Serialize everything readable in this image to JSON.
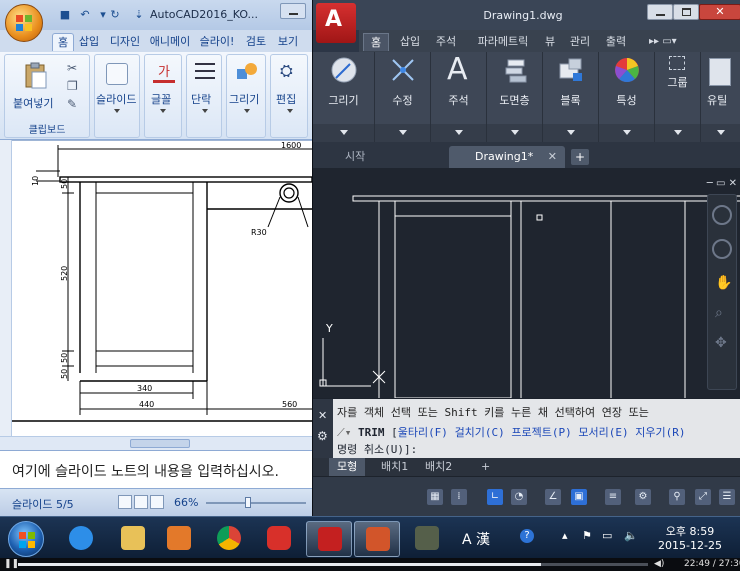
{
  "ppt": {
    "title": "AutoCAD2016_KO...",
    "tabs": [
      "홈",
      "삽입",
      "디자인",
      "애니메이",
      "슬라이!",
      "검토",
      "보기"
    ],
    "active_tab": "홈",
    "groups": {
      "clipboard": {
        "paste_label": "붙여넣기",
        "group_label": "클립보드"
      },
      "slides": {
        "label": "슬라이드"
      },
      "font": {
        "label": "글꼴"
      },
      "paragraph": {
        "label": "단락"
      },
      "drawing": {
        "label": "그리기"
      },
      "editing": {
        "label": "편집"
      }
    },
    "notes_text": "여기에 슬라이드 노트의 내용을 입력하십시오.",
    "status_slide": "슬라이드 5/5",
    "zoom": "66%",
    "drawing": {
      "dims": [
        "1600",
        "10",
        "50",
        "520",
        "50",
        "50",
        "340",
        "440",
        "560",
        "R30"
      ]
    }
  },
  "acad": {
    "logo_letter": "A",
    "title": "Drawing1.dwg",
    "tabs": [
      "홈",
      "삽입",
      "주석",
      "파라메트릭",
      "뷰",
      "관리",
      "출력"
    ],
    "active_tab": "홈",
    "panels": [
      "그리기",
      "수정",
      "주석",
      "도면층",
      "블록",
      "특성",
      "그룹",
      "유틸"
    ],
    "file_tabs": [
      "시작",
      "Drawing1*"
    ],
    "active_file_tab": "Drawing1*",
    "ucs_y_label": "Y",
    "command_history": "자를 객체 선택 또는 Shift 키를 누른 채 선택하여 연장 또는",
    "command_prompt": {
      "name": "TRIM",
      "options": [
        "울타리(F)",
        "걸치기(C)",
        "프로젝트(P)",
        "모서리(E)",
        "지우기(R)"
      ],
      "line2": "명령 취소(U)]:"
    },
    "layout_tabs": [
      "모형",
      "배치1",
      "배치2"
    ],
    "active_layout": "모형"
  },
  "taskbar": {
    "apps": [
      "ie",
      "explorer",
      "media-player",
      "chrome",
      "oneclick",
      "autocad",
      "powerpoint",
      "plugin"
    ],
    "active_apps": [
      "autocad",
      "powerpoint"
    ],
    "tray_lang": "A 漢",
    "time": "오후 8:59",
    "date": "2015-12-25"
  },
  "player": {
    "time": "22:49 / 27:30",
    "progress": 0.83
  },
  "colors": {
    "ppt_ribbon_bg": "#dfe8f5",
    "acad_bg": "#2c3646",
    "acad_viewport": "#1f252f",
    "acad_logo": "#c42020",
    "cmd_option": "#1c48b8"
  }
}
